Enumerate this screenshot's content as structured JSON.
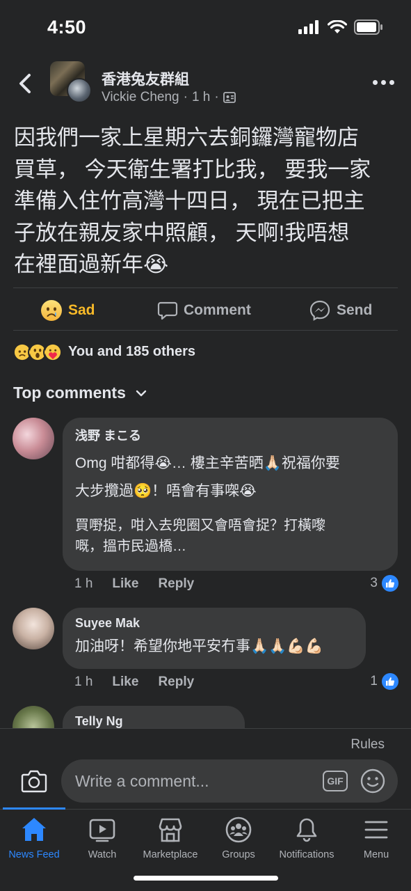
{
  "status_bar": {
    "time": "4:50"
  },
  "header": {
    "group_name": "香港兔友群組",
    "author": "Vickie Cheng",
    "separator": "·",
    "time": "1 h",
    "separator2": "·"
  },
  "post": {
    "text": "因我們一家上星期六去銅鑼灣寵物店\n買草， 今天衛生署打比我， 要我一家\n準備入住竹高灣十四日， 現在已把主\n子放在親友家中照顧， 天啊!我唔想\n在裡面過新年😭"
  },
  "actions": {
    "sad": "Sad",
    "comment": "Comment",
    "send": "Send"
  },
  "reactions": {
    "summary": "You and 185 others"
  },
  "top_comments_label": "Top comments",
  "comments": [
    {
      "name": "浅野 まこる",
      "text": "Omg 咁都得😭… 樓主辛苦晒🙏🏻祝福你要\n大步攬過🥺！唔會有事㗎😭",
      "text2": "買嘢捉，咁入去兜圈又會唔會捉？打橫嚟\n嘅，搵市民過橋…",
      "time": "1 h",
      "like": "Like",
      "reply": "Reply",
      "likes": "3"
    },
    {
      "name": "Suyee Mak",
      "text": "加油呀！希望你地平安冇事🙏🏻🙏🏻💪🏻💪🏻",
      "time": "1 h",
      "like": "Like",
      "reply": "Reply",
      "likes": "1"
    },
    {
      "name": "Telly Ng"
    }
  ],
  "composer": {
    "rules": "Rules",
    "placeholder": "Write a comment...",
    "gif": "GIF"
  },
  "tabs": [
    {
      "label": "News Feed",
      "icon": "home-icon",
      "active": true
    },
    {
      "label": "Watch",
      "icon": "watch-icon"
    },
    {
      "label": "Marketplace",
      "icon": "marketplace-icon"
    },
    {
      "label": "Groups",
      "icon": "groups-icon"
    },
    {
      "label": "Notifications",
      "icon": "bell-icon"
    },
    {
      "label": "Menu",
      "icon": "menu-icon"
    }
  ],
  "colors": {
    "background": "#242526",
    "bubble": "#3a3b3c",
    "accent": "#2d88ff",
    "sad": "#f7b928",
    "secondary_text": "#b0b3b8"
  }
}
